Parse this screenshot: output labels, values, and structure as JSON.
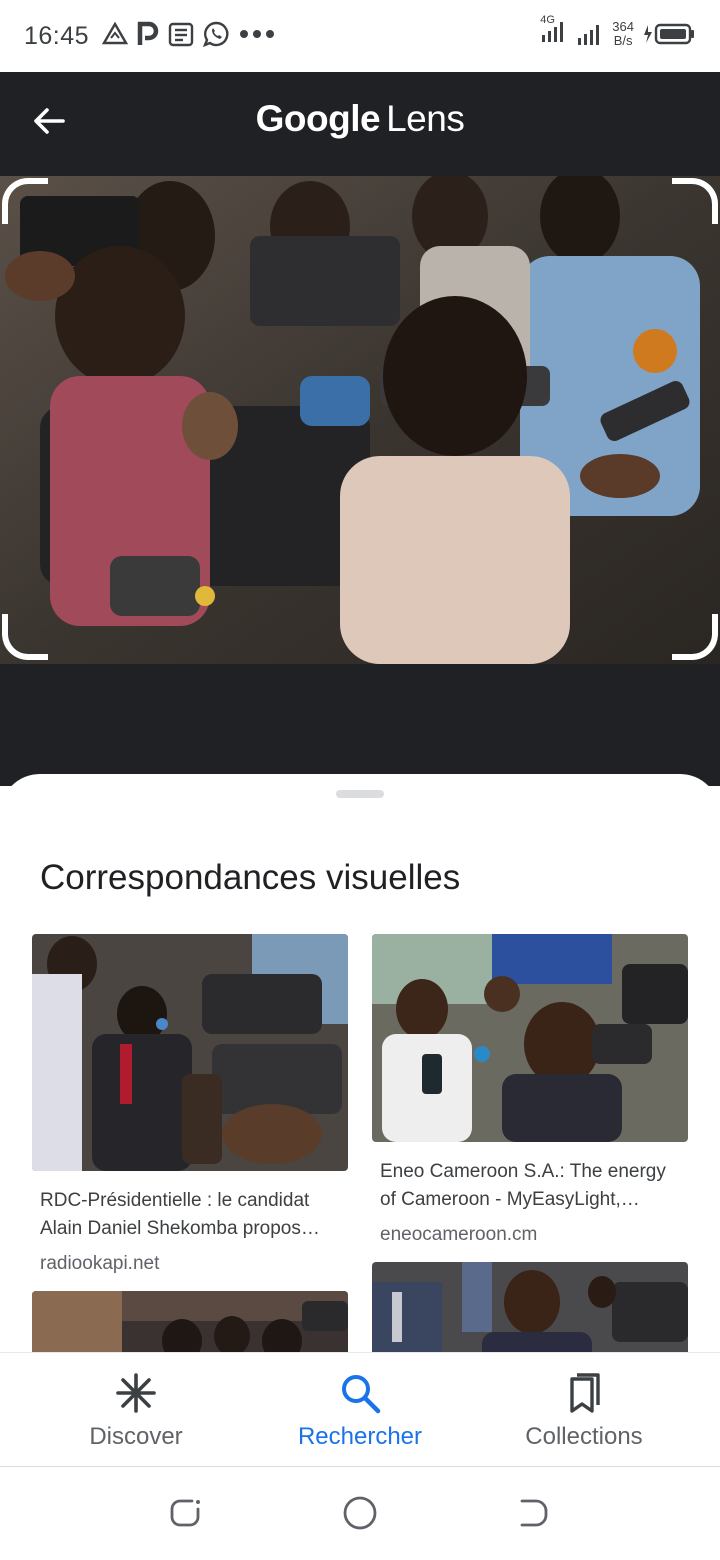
{
  "status_bar": {
    "time": "16:45",
    "left_icons": [
      "warning-triangle-icon",
      "parking-icon",
      "news-icon",
      "whatsapp-icon",
      "more-dots-icon"
    ],
    "network_type": "4G",
    "speed_value": "364",
    "speed_unit": "B/s"
  },
  "app_bar": {
    "title_brand": "Google",
    "title_product": "Lens"
  },
  "results": {
    "section_title": "Correspondances visuelles",
    "cards": [
      {
        "title": "RDC-Présidentielle : le candidat Alain Daniel Shekomba propos…",
        "source": "radiookapi.net"
      },
      {
        "title": "Eneo Cameroon S.A.: The energy of Cameroon - MyEasyLight,…",
        "source": "eneocameroon.cm"
      }
    ]
  },
  "bottom_nav": {
    "items": [
      {
        "label": "Discover",
        "icon": "discover-asterisk-icon",
        "active": false
      },
      {
        "label": "Rechercher",
        "icon": "search-icon",
        "active": true
      },
      {
        "label": "Collections",
        "icon": "collections-bookmark-icon",
        "active": false
      }
    ]
  },
  "colors": {
    "accent": "#1a73e8",
    "app_bar_bg": "#202124",
    "text_primary": "#202124",
    "text_secondary": "#5f6368"
  }
}
